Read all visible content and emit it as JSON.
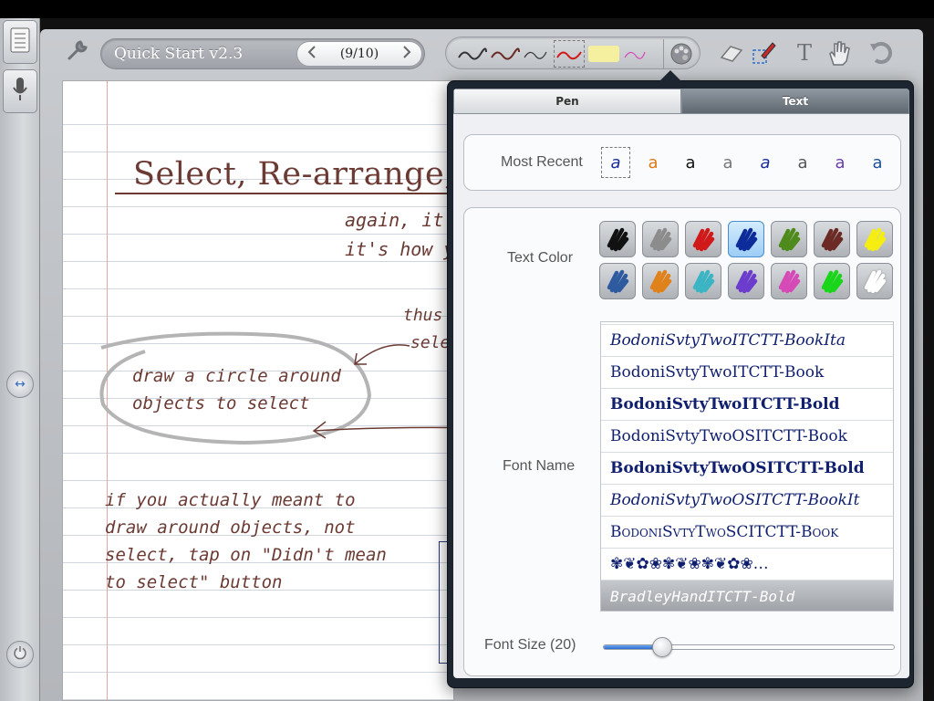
{
  "toolbar": {
    "doc_title": "Quick Start v2.3",
    "page_indicator": "(9/10)",
    "text_tool_label": "T"
  },
  "note": {
    "heading": "Select, Re-arrange,",
    "lines": [
      "again, it's",
      "it's how yo",
      "thus",
      "selec"
    ],
    "circle_text": [
      "draw a circle around",
      "objects to select"
    ],
    "tip": [
      "if you actually meant to",
      "draw around objects, not",
      "select, tap on \"Didn't mean",
      "to select\" button"
    ]
  },
  "popover": {
    "tabs": [
      {
        "label": "Pen",
        "selected": false
      },
      {
        "label": "Text",
        "selected": true
      }
    ],
    "most_recent_label": "Most Recent",
    "most_recent": [
      {
        "glyph": "a",
        "color": "#1a2a9a",
        "style": "italic"
      },
      {
        "glyph": "a",
        "color": "#e07a14",
        "style": "normal"
      },
      {
        "glyph": "a",
        "color": "#111111",
        "style": "normal"
      },
      {
        "glyph": "a",
        "color": "#777777",
        "style": "normal"
      },
      {
        "glyph": "a",
        "color": "#1a2a9a",
        "style": "italic"
      },
      {
        "glyph": "a",
        "color": "#555555",
        "style": "normal"
      },
      {
        "glyph": "a",
        "color": "#6a3db0",
        "style": "normal"
      },
      {
        "glyph": "a",
        "color": "#1d4f9a",
        "style": "normal"
      }
    ],
    "text_color_label": "Text Color",
    "text_colors": [
      "#111111",
      "#8c8c8c",
      "#d01a1a",
      "#0d2c9a",
      "#4f8a1c",
      "#6b2a24",
      "#f5ee10",
      "#2e5aa0",
      "#e0821c",
      "#3bb4c4",
      "#6c3ccc",
      "#d64ab8",
      "#1ad61a",
      "#ffffff"
    ],
    "selected_color": "#0d2c9a",
    "font_name_label": "Font Name",
    "fonts": [
      {
        "name": "BodoniSvtyTwoITCTT-BookIta",
        "weight": "normal",
        "style": "italic",
        "variant": "normal"
      },
      {
        "name": "BodoniSvtyTwoITCTT-Book",
        "weight": "normal",
        "style": "normal",
        "variant": "normal"
      },
      {
        "name": "BodoniSvtyTwoITCTT-Bold",
        "weight": "bold",
        "style": "normal",
        "variant": "normal"
      },
      {
        "name": "BodoniSvtyTwoOSITCTT-Book",
        "weight": "normal",
        "style": "normal",
        "variant": "normal"
      },
      {
        "name": "BodoniSvtyTwoOSITCTT-Bold",
        "weight": "bold",
        "style": "normal",
        "variant": "normal"
      },
      {
        "name": "BodoniSvtyTwoOSITCTT-BookIt",
        "weight": "normal",
        "style": "italic",
        "variant": "normal"
      },
      {
        "name": "BodoniSvtyTwoSCITCTT-Book",
        "weight": "normal",
        "style": "normal",
        "variant": "small-caps"
      },
      {
        "name": "✾❦✿❀✾❦❀✾❦✿❀…",
        "weight": "normal",
        "style": "normal",
        "variant": "normal"
      },
      {
        "name": "BradleyHandITCTT-Bold",
        "weight": "normal",
        "style": "normal",
        "variant": "normal",
        "selected": true
      }
    ],
    "font_size_label": "Font Size (20)",
    "font_size_fraction": 0.18
  },
  "colors": {
    "ink": "#6b3a33",
    "accent_blue": "#2d6cd0"
  }
}
